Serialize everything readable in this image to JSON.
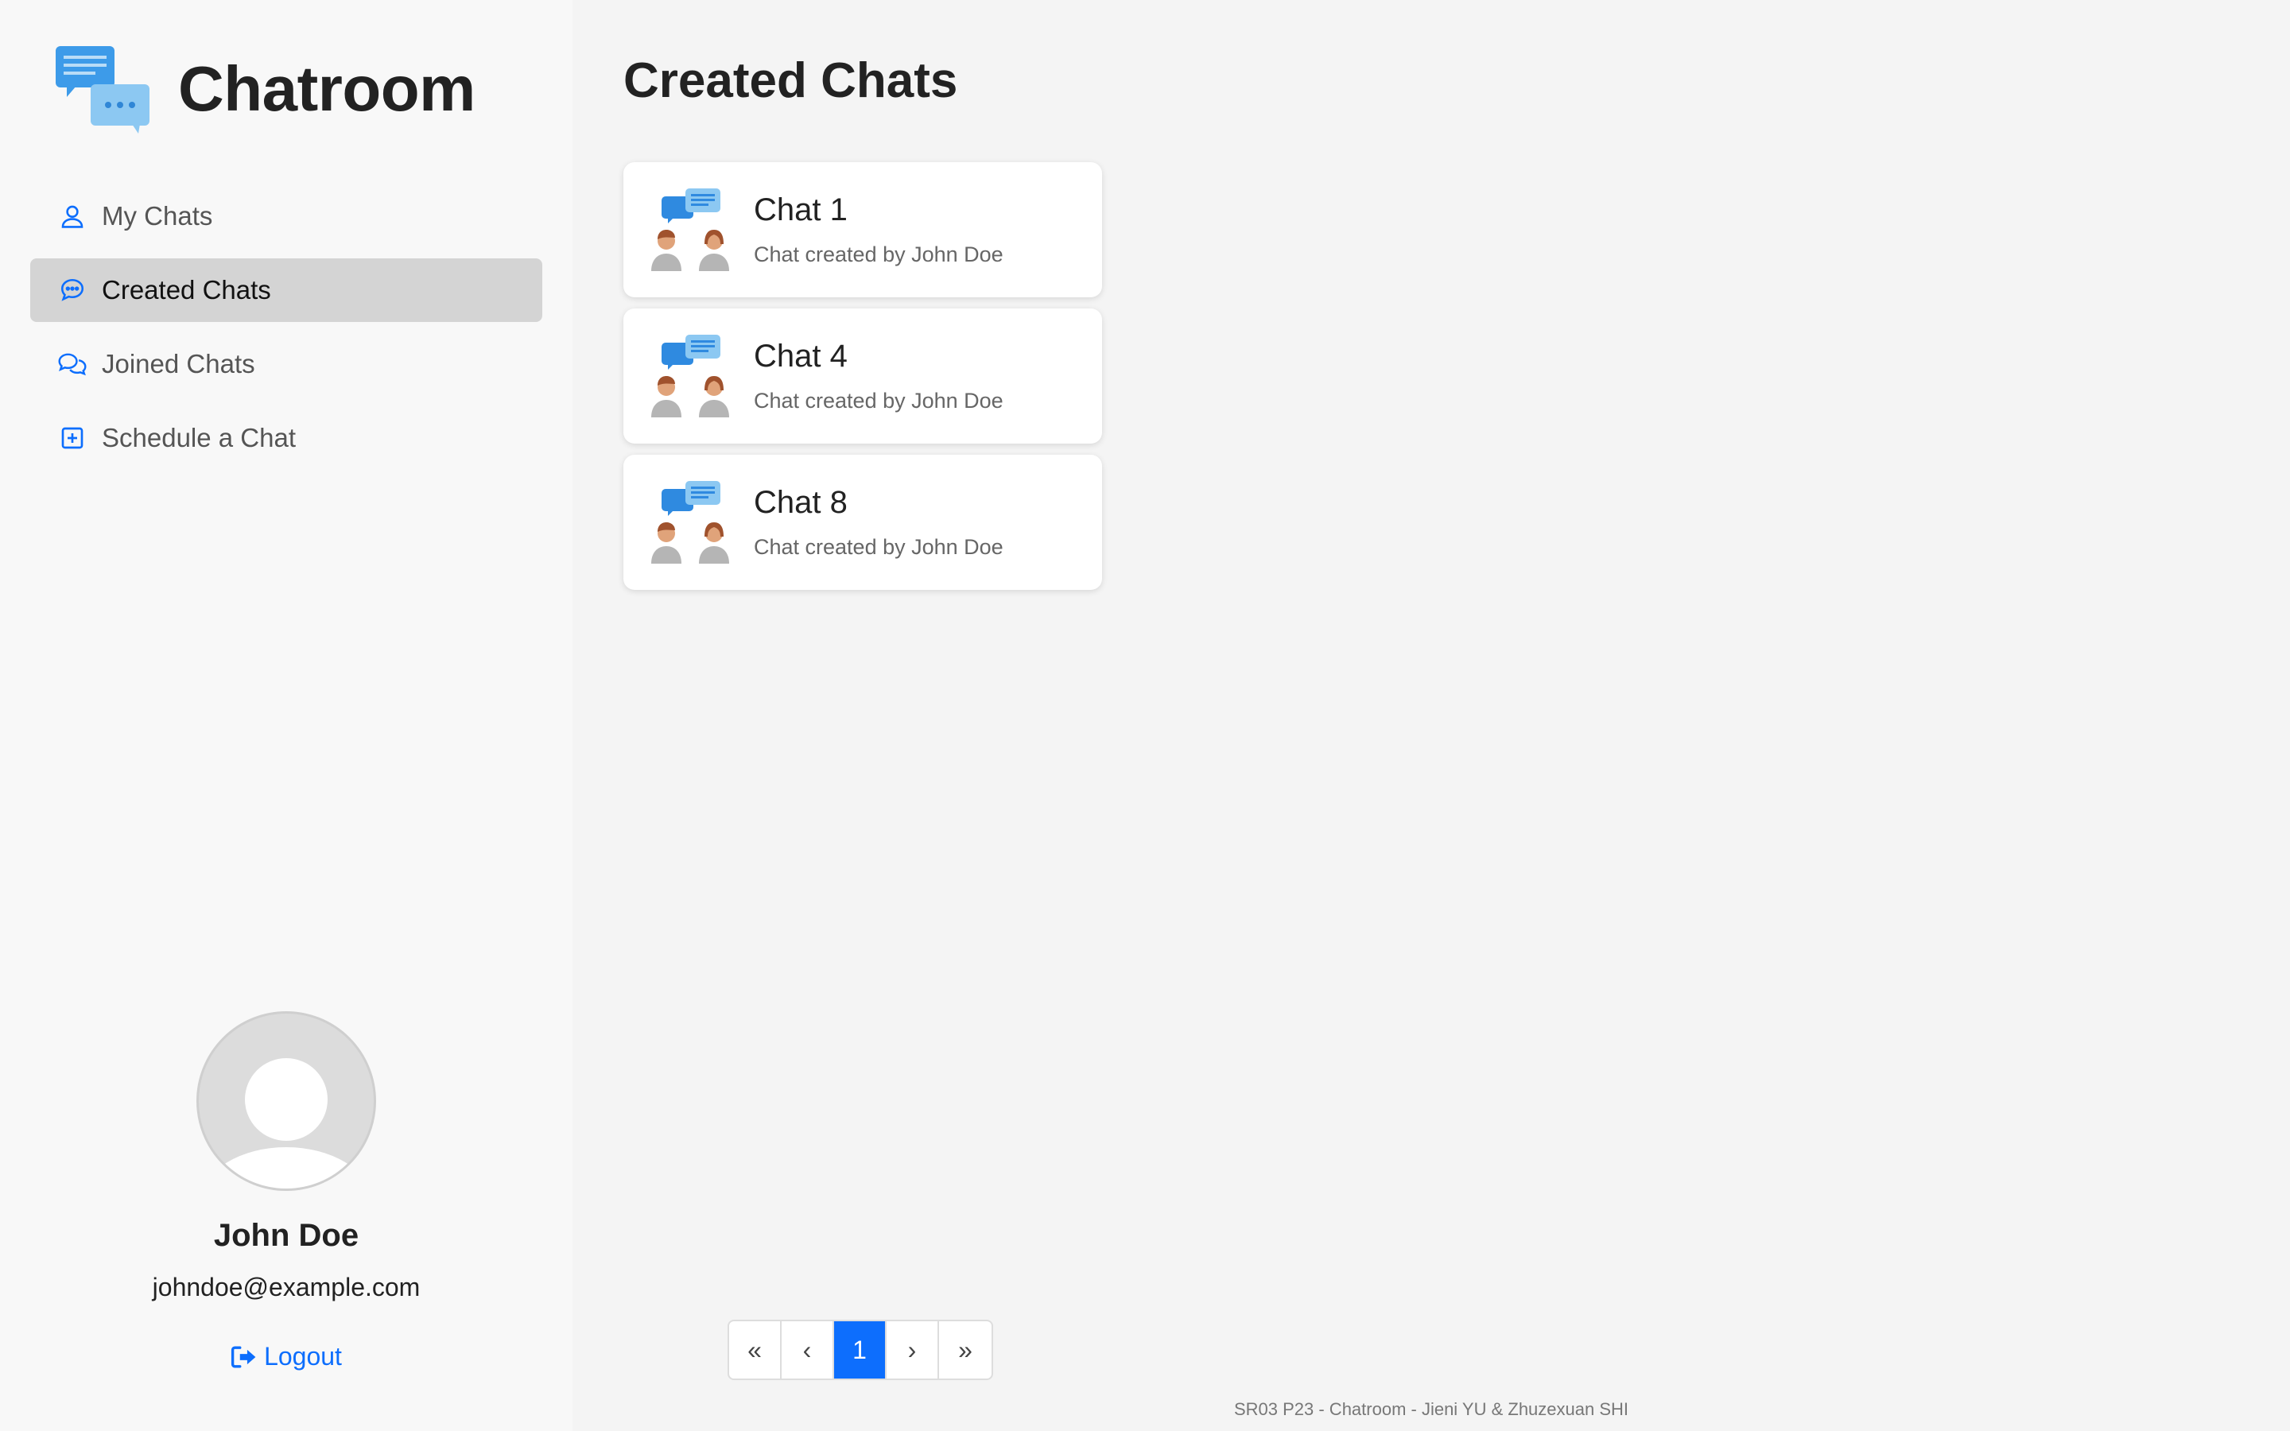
{
  "brand": {
    "title": "Chatroom"
  },
  "nav": {
    "items": [
      {
        "label": "My Chats",
        "icon": "user-icon",
        "active": false
      },
      {
        "label": "Created Chats",
        "icon": "chat-bubble-icon",
        "active": true
      },
      {
        "label": "Joined Chats",
        "icon": "chats-icon",
        "active": false
      },
      {
        "label": "Schedule a Chat",
        "icon": "plus-square-icon",
        "active": false
      }
    ]
  },
  "user": {
    "name": "John Doe",
    "email": "johndoe@example.com",
    "logout_label": "Logout"
  },
  "main": {
    "title": "Created Chats",
    "chats": [
      {
        "title": "Chat 1",
        "subtitle": "Chat created by John Doe"
      },
      {
        "title": "Chat 4",
        "subtitle": "Chat created by John Doe"
      },
      {
        "title": "Chat 8",
        "subtitle": "Chat created by John Doe"
      }
    ]
  },
  "pagination": {
    "first": "«",
    "prev": "‹",
    "current": "1",
    "next": "›",
    "last": "»"
  },
  "footer": {
    "text": "SR03 P23 - Chatroom - Jieni YU & Zhuzexuan SHI"
  },
  "colors": {
    "accent": "#0d6efd",
    "active_nav_bg": "#d4d4d4",
    "logo_blue": "#3d9be9"
  }
}
